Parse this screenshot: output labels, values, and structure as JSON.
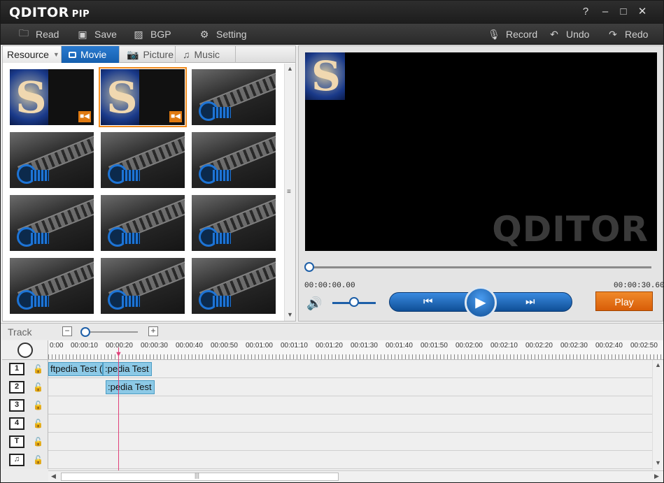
{
  "app": {
    "logo": "QDITOR",
    "logo_suffix": "PIP"
  },
  "window": {
    "help": "?",
    "minimize": "–",
    "maximize": "□",
    "close": "✕"
  },
  "toolbar": {
    "read": "Read",
    "save": "Save",
    "bgp": "BGP",
    "setting": "Setting",
    "record": "Record",
    "undo": "Undo",
    "redo": "Redo"
  },
  "resource_tabs": {
    "resource": "Resource",
    "movie": "Movie",
    "picture": "Picture",
    "music": "Music"
  },
  "thumbnails": [
    {
      "type": "video-s",
      "selected": false
    },
    {
      "type": "video-s",
      "selected": true
    },
    {
      "type": "film"
    },
    {
      "type": "film"
    },
    {
      "type": "film"
    },
    {
      "type": "film"
    },
    {
      "type": "film"
    },
    {
      "type": "film"
    },
    {
      "type": "film"
    },
    {
      "type": "film"
    },
    {
      "type": "film"
    },
    {
      "type": "film"
    }
  ],
  "preview": {
    "watermark": "QDITOR",
    "time_current": "00:00:00.00",
    "time_total": "00:00:30.60",
    "play_label": "Play",
    "seek_fraction": 0.0
  },
  "track": {
    "label": "Track",
    "ruler": [
      "0:00",
      "00:00:10",
      "00:00:20",
      "00:00:30",
      "00:00:40",
      "00:00:50",
      "00:01:00",
      "00:01:10",
      "00:01:20",
      "00:01:30",
      "00:01:40",
      "00:01:50",
      "00:02:00",
      "00:02:10",
      "00:02:20",
      "00:02:30",
      "00:02:40",
      "00:02:50"
    ],
    "rows": [
      {
        "num": "1",
        "clips": [
          "ftpedia Test (",
          ":pedia Test ("
        ]
      },
      {
        "num": "2",
        "clips": [
          ":pedia Test ("
        ]
      },
      {
        "num": "3",
        "clips": []
      },
      {
        "num": "4",
        "clips": []
      },
      {
        "num": "T",
        "clips": []
      },
      {
        "num": "♫",
        "clips": []
      }
    ]
  },
  "colors": {
    "accent": "#1d5fa8",
    "tab_active": "#2a7bd0",
    "play": "#e07a10",
    "clip": "#8cc9e6",
    "playhead": "#e0407a"
  },
  "icons": [
    "folder-icon",
    "save-icon",
    "image-icon",
    "gear-icon",
    "mic-icon",
    "undo-icon",
    "redo-icon",
    "camera-icon",
    "music-note-icon",
    "volume-icon"
  ]
}
